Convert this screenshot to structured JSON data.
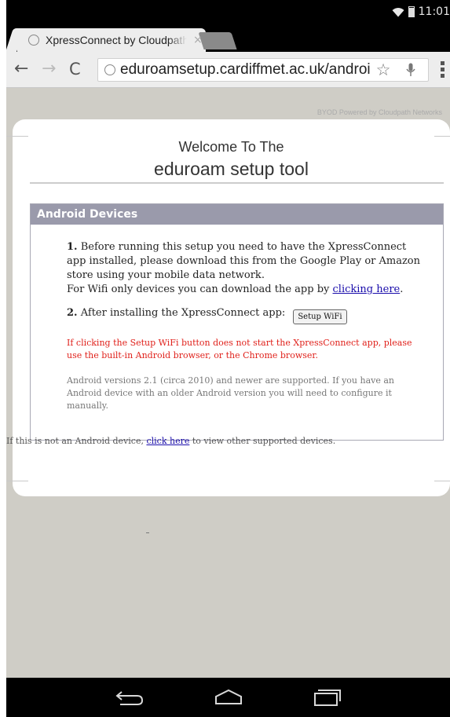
{
  "status_bar": {
    "time": "11:01",
    "icons": [
      "wifi-icon",
      "battery-icon"
    ]
  },
  "tab": {
    "title": "XpressConnect by Cloudpath Networks",
    "close_glyph": "×",
    "icon": "globe-icon"
  },
  "toolbar": {
    "back_glyph": "←",
    "forward_glyph": "→",
    "reload_glyph": "C",
    "url": "eduroamsetup.cardiffmet.ac.uk/android",
    "bookmark_glyph": "☆",
    "mic_icon": "microphone-icon",
    "menu_icon": "overflow-menu-icon"
  },
  "page": {
    "byod_credit": "BYOD Powered by Cloudpath Networks",
    "welcome": "Welcome To The",
    "tool_title": "eduroam setup tool",
    "section_title": "Android Devices",
    "step1_num": "1.",
    "step1_text": "Before running this setup you need to have the XpressConnect app installed, please download this from the Google Play or Amazon store using your mobile data network.",
    "step1_wifi_prefix": "For Wifi only devices you can download the app by",
    "step1_link": "clicking here",
    "step1_suffix": ".",
    "step2_num": "2.",
    "step2_text": "After installing the XpressConnect app:",
    "setup_button": "Setup WiFi",
    "warning": "If clicking the Setup WiFi button does not start the XpressConnect app, please use the built-in Android browser, or the Chrome browser.",
    "note": "Android versions 2.1 (circa 2010) and newer are supported. If you have an Android device with an older Android version you will need to configure it manually.",
    "other_prefix": "If this is not an Android device,",
    "other_link": "click here",
    "other_suffix": "to view other supported devices."
  },
  "navbar": {
    "buttons": [
      "back-nav-icon",
      "home-nav-icon",
      "recents-nav-icon"
    ]
  },
  "colors": {
    "page_background": "#cfcdc6",
    "section_header": "#9a9aab",
    "warning_text": "#e0211b",
    "link": "#1a0dab"
  }
}
